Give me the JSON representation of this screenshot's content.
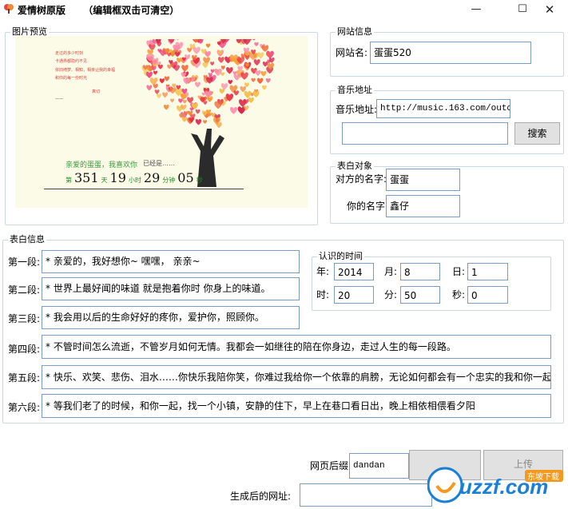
{
  "window": {
    "title": "爱情树原版",
    "hint": "（编辑框双击可清空）",
    "minimize": "—",
    "maximize": "☐",
    "close": "✕"
  },
  "preview": {
    "legend": "图片预览",
    "poem_lines": [
      "走过的多少时刻",
      "卡通界都隐约不见",
      "依旧绮梦、相知，相亲让我的幸福",
      "和你的每一份时光",
      "——",
      "真切"
    ],
    "dear_text": "亲爱的蛋蛋，我喜欢你",
    "already_text": "已经是……",
    "counter": {
      "prefix": "第",
      "days": "351",
      "days_unit": "天",
      "hours": "19",
      "hours_unit": "小时",
      "minutes": "29",
      "minutes_unit": "分钟",
      "seconds": "05",
      "seconds_unit": "秒"
    }
  },
  "site_info": {
    "legend": "网站信息",
    "name_label": "网站名:",
    "name_value": "蛋蛋520"
  },
  "music": {
    "legend": "音乐地址",
    "url_label": "音乐地址:",
    "url_value": "http://music.163.com/outchain/p",
    "search_value": "",
    "search_button": "搜索"
  },
  "target": {
    "legend": "表白对象",
    "partner_label": "对方的名字:",
    "partner_value": "蛋蛋",
    "my_label": "你的名字:",
    "my_value": "鑫仔"
  },
  "confession": {
    "legend": "表白信息",
    "lines": [
      {
        "label": "第一段:",
        "value": "* 亲爱的，我好想你~ 嘿嘿， 亲亲~"
      },
      {
        "label": "第二段:",
        "value": "* 世界上最好闻的味道 就是抱着你时 你身上的味道。"
      },
      {
        "label": "第三段:",
        "value": "* 我会用以后的生命好好的疼你，爱护你，照顾你。"
      },
      {
        "label": "第四段:",
        "value": "* 不管时间怎么流逝，不管岁月如何无情。我都会一如继往的陪在你身边，走过人生的每一段路。"
      },
      {
        "label": "第五段:",
        "value": "* 快乐、欢笑、悲伤、泪水……你快乐我陪你笑，你难过我给你一个依靠的肩膀，无论如何都会有一个忠实的我和你一起度过！"
      },
      {
        "label": "第六段:",
        "value": "* 等我们老了的时候，和你一起，找一个小镇，安静的住下，早上在巷口看日出，晚上相依相偎看夕阳"
      }
    ]
  },
  "met_time": {
    "legend": "认识的时间",
    "year_label": "年:",
    "year": "2014",
    "month_label": "月:",
    "month": "8",
    "day_label": "日:",
    "day": "1",
    "hour_label": "时:",
    "hour": "20",
    "minute_label": "分:",
    "minute": "50",
    "second_label": "秒:",
    "second": "0"
  },
  "footer": {
    "suffix_label": "网页后缀:",
    "suffix_value": "dandan",
    "generate_button": "",
    "upload_button": "上传",
    "url_label": "生成后的网址:",
    "url_value": ""
  },
  "watermark": {
    "text": "uzzf.com",
    "tag": "东坡下载"
  },
  "colors": {
    "border": "#c9d7e6",
    "input_border": "#7a9cc6",
    "watermark_blue": "#1a7fd6",
    "watermark_orange": "#f39a1e"
  }
}
